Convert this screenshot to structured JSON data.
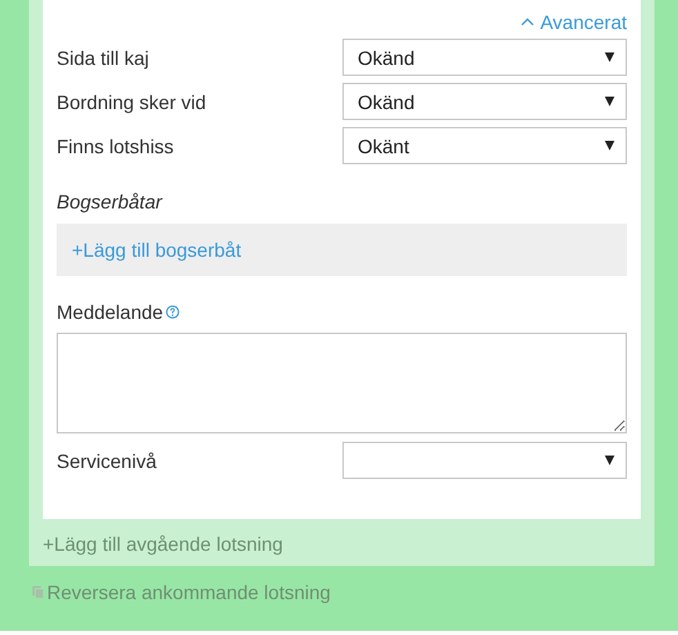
{
  "advanced_toggle": {
    "label": "Avancerat",
    "expanded": true
  },
  "fields": [
    {
      "label": "Sida till kaj",
      "value": "Okänd"
    },
    {
      "label": "Bordning sker vid",
      "value": "Okänd"
    },
    {
      "label": "Finns lotshiss",
      "value": "Okänt"
    }
  ],
  "tugs": {
    "heading": "Bogserbåtar",
    "add_link": "+Lägg till bogserbåt"
  },
  "message": {
    "label": "Meddelande"
  },
  "service_level": {
    "label": "Servicenivå"
  },
  "add_departure_link": "+Lägg till avgående lotsning",
  "reverse_link": "Reversera ankommande lotsning"
}
